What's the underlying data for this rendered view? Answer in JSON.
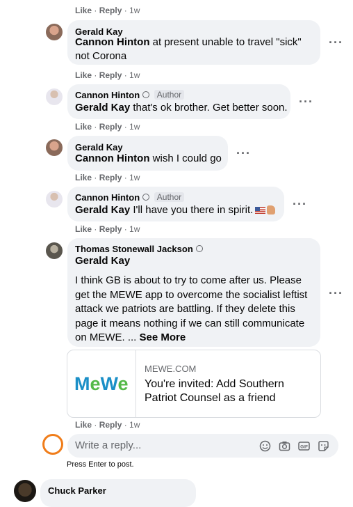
{
  "top_actions": {
    "like": "Like",
    "reply": "Reply",
    "time": "1w"
  },
  "comments": [
    {
      "author": "Gerald Kay",
      "mention": "Cannon Hinton",
      "text": " at present unable to travel \"sick\"",
      "text2": "not Corona",
      "like": "Like",
      "reply": "Reply",
      "time": "1w"
    },
    {
      "author": "Cannon Hinton",
      "badge": "Author",
      "mention": "Gerald Kay",
      "text": " that's ok brother. Get better soon.",
      "like": "Like",
      "reply": "Reply",
      "time": "1w"
    },
    {
      "author": "Gerald Kay",
      "mention": "Cannon Hinton",
      "text": " wish I could go",
      "like": "Like",
      "reply": "Reply",
      "time": "1w"
    },
    {
      "author": "Cannon Hinton",
      "badge": "Author",
      "mention": "Gerald Kay",
      "text": " I'll have you there in spirit.",
      "emoji": "flag-and-thumbs-up",
      "like": "Like",
      "reply": "Reply",
      "time": "1w"
    },
    {
      "author": "Thomas Stonewall Jackson",
      "mention": "Gerald Kay",
      "lines": [
        "I think GB is about to try to come after us. Please",
        "get the MEWE app to overcome the socialist leftist",
        "attack we patriots are battling. If they delete this",
        "page it means nothing if we can still communicate"
      ],
      "last_line": "on MEWE. ...",
      "see_more": "See More",
      "like": "Like",
      "reply": "Reply",
      "time": "1w"
    }
  ],
  "link_preview": {
    "logo": "MeWe",
    "domain": "MEWE.COM",
    "title_line1": "You're invited: Add Southern",
    "title_line2": "Patriot Counsel as a friend"
  },
  "reply_box": {
    "placeholder": "Write a reply...",
    "hint": "Press Enter to post."
  },
  "next_comment": {
    "author": "Chuck Parker"
  },
  "colors": {
    "bubble": "#f0f2f5",
    "meta": "#65676b",
    "reply_ring": "#f07d1a",
    "mewe_blue": "#1a8fc7",
    "mewe_green": "#54b948"
  }
}
